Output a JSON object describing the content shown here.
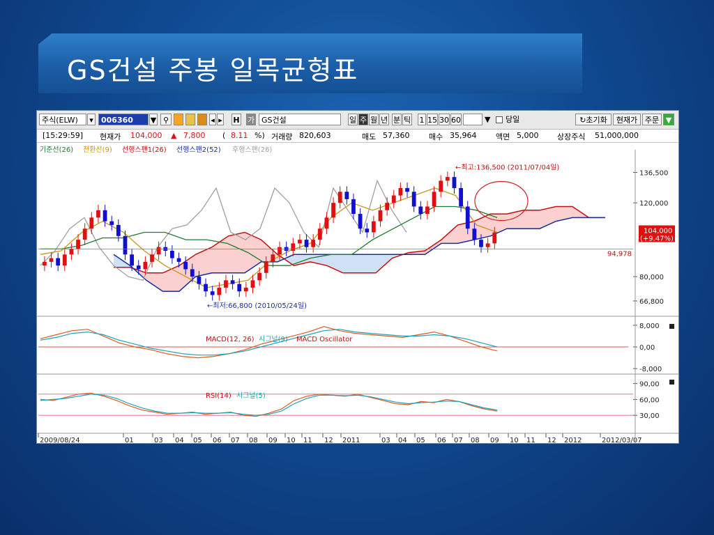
{
  "slide": {
    "title": "GS건설 주봉 일목균형표"
  },
  "toolbar": {
    "market_select": "주식(ELW)",
    "code": "006360",
    "h_button": "H",
    "name_badge": "가",
    "stock_name": "GS건설",
    "period_day": "일",
    "period_week": "주",
    "period_month": "월",
    "period_year": "년",
    "period_minute": "분",
    "period_tick": "틱",
    "interval_1": "1",
    "interval_15": "15",
    "interval_30": "30",
    "interval_60": "60",
    "same_day_label": "당일",
    "reset_button": "초기화",
    "current_price_button": "현재가",
    "order_button": "주문"
  },
  "info": {
    "time": "[15:29:59]",
    "price_label": "현재가",
    "price": "104,000",
    "change_arrow": "▲",
    "change": "7,800",
    "pct_open": "(",
    "pct": "8.11",
    "pct_close": "%)",
    "volume_label": "거래량",
    "volume": "820,603",
    "ask_label": "매도",
    "ask": "57,360",
    "bid_label": "매수",
    "bid": "35,964",
    "face_label": "액면",
    "face": "5,000",
    "listed_label": "상장주식",
    "listed": "51,000,000"
  },
  "legend": {
    "base": "기준선(26)",
    "conversion": "전환선(9)",
    "span1": "선행스팬1(26)",
    "span2": "선행스팬2(52)",
    "lagging": "후행스팬(26)"
  },
  "annotations": {
    "high": "←최고:136,500 (2011/07/04일)",
    "low": "←최저:66,800 (2010/05/24일)",
    "price_line": "94,978",
    "current_box_price": "104,000",
    "current_box_pct": "(+9.47%)"
  },
  "macd": {
    "label1": "MACD(12, 26)",
    "label2": "시그널(9)",
    "label3": "MACD Oscillator"
  },
  "rsi": {
    "label1": "RSI(14)",
    "label2": "시그널(5)"
  },
  "colors": {
    "base": "#1f7a2e",
    "conversion": "#c9961a",
    "span1": "#c01010",
    "span2": "#1a2f9a",
    "lagging": "#a0a0a0",
    "candle_up": "#e01010",
    "candle_down": "#1010d0"
  },
  "chart_data": [
    {
      "type": "line",
      "chart": "ichimoku candlestick",
      "y_ticks": [
        "136,500",
        "120,000",
        "80,000",
        "66,800"
      ],
      "ylim": [
        60000,
        145000
      ],
      "x_ticks": [
        "2009/08/24",
        "01",
        "03",
        "04",
        "05",
        "06",
        "07",
        "08",
        "09",
        "10",
        "11",
        "12",
        "2011",
        "03",
        "04",
        "05",
        "06",
        "07",
        "08",
        "09",
        "10",
        "11",
        "12",
        "2012",
        "2012/03/07"
      ],
      "candles_close": [
        88000,
        90000,
        86000,
        92000,
        95000,
        100000,
        106000,
        112000,
        116000,
        110000,
        108000,
        102000,
        92000,
        86000,
        84000,
        88000,
        92000,
        96000,
        94000,
        90000,
        88000,
        84000,
        80000,
        76000,
        72000,
        70000,
        74000,
        78000,
        76000,
        72000,
        74000,
        78000,
        82000,
        88000,
        92000,
        96000,
        94000,
        98000,
        100000,
        96000,
        100000,
        106000,
        112000,
        120000,
        126000,
        122000,
        114000,
        106000,
        104000,
        110000,
        116000,
        120000,
        124000,
        128000,
        126000,
        118000,
        114000,
        118000,
        126000,
        132000,
        134000,
        128000,
        118000,
        106000,
        100000,
        96000,
        98000,
        104000
      ],
      "series": [
        {
          "name": "기준선(26)",
          "values": [
            95000,
            95000,
            97000,
            101000,
            101000,
            104000,
            104000,
            100000,
            100000,
            98000,
            93000,
            86000,
            86000,
            90000,
            92000,
            92000,
            100000,
            106000,
            112000,
            118000,
            118000,
            116000,
            112000
          ]
        },
        {
          "name": "전환선(9)",
          "values": [
            92000,
            94000,
            104000,
            110000,
            104000,
            94000,
            86000,
            80000,
            74000,
            76000,
            78000,
            88000,
            94000,
            98000,
            112000,
            120000,
            116000,
            120000,
            124000,
            128000,
            124000,
            108000,
            104000
          ]
        },
        {
          "name": "선행스팬1(26)",
          "values": [
            85000,
            85000,
            82000,
            82000,
            86000,
            92000,
            96000,
            102000,
            104000,
            100000,
            92000,
            86000,
            88000,
            86000,
            82000,
            82000,
            82000,
            90000,
            93000,
            94000,
            100000,
            108000,
            110000,
            114000,
            114000,
            116000,
            116000,
            118000,
            118000,
            112000,
            112000
          ]
        },
        {
          "name": "선행스팬2(52)",
          "values": [
            92000,
            86000,
            78000,
            72000,
            72000,
            80000,
            82000,
            82000,
            82000,
            88000,
            88000,
            92000,
            92000,
            92000,
            92000,
            92000,
            92000,
            92000,
            92000,
            92000,
            98000,
            98000,
            100000,
            102000,
            106000,
            106000,
            106000,
            110000,
            112000,
            112000,
            112000
          ]
        },
        {
          "name": "후행스팬(26)",
          "values": [
            86000,
            94000,
            106000,
            112000,
            96000,
            86000,
            80000,
            78000,
            96000,
            106000,
            108000,
            116000,
            128000,
            104000,
            100000,
            106000,
            128000,
            120000,
            104000,
            96000,
            128000,
            116000,
            104000,
            132000,
            116000,
            104000
          ]
        }
      ]
    },
    {
      "type": "line",
      "chart": "MACD",
      "y_ticks": [
        "8,000",
        "0,00",
        "-8,000"
      ],
      "ylim": [
        -9000,
        9000
      ],
      "series": [
        {
          "name": "MACD(12, 26)",
          "values": [
            3000,
            4500,
            6000,
            6500,
            4000,
            1500,
            0,
            -1000,
            -2500,
            -3500,
            -4000,
            -3500,
            -2500,
            -1000,
            1000,
            2500,
            4000,
            5500,
            7500,
            6000,
            5000,
            4500,
            4000,
            3500,
            4500,
            5500,
            4000,
            2000,
            0,
            -1500
          ]
        },
        {
          "name": "시그널(9)",
          "values": [
            2500,
            3500,
            5000,
            5500,
            4500,
            2500,
            1000,
            -500,
            -1500,
            -2500,
            -3000,
            -3000,
            -2500,
            -1500,
            0,
            1500,
            3000,
            4500,
            6000,
            6500,
            5500,
            5000,
            4500,
            4000,
            4000,
            4500,
            4000,
            3000,
            1500,
            0
          ]
        }
      ]
    },
    {
      "type": "line",
      "chart": "RSI",
      "y_ticks": [
        "90,00",
        "60,00",
        "30,00"
      ],
      "ylim": [
        0,
        100
      ],
      "series": [
        {
          "name": "RSI(14)",
          "values": [
            60,
            58,
            64,
            70,
            72,
            66,
            58,
            48,
            40,
            36,
            32,
            34,
            36,
            32,
            34,
            36,
            30,
            28,
            34,
            42,
            58,
            66,
            70,
            68,
            66,
            70,
            64,
            58,
            52,
            50,
            56,
            54,
            60,
            56,
            48,
            42,
            38
          ]
        },
        {
          "name": "시그널(5)",
          "values": [
            58,
            60,
            62,
            66,
            70,
            68,
            62,
            52,
            44,
            38,
            34,
            34,
            35,
            34,
            34,
            35,
            32,
            30,
            32,
            38,
            52,
            62,
            68,
            68,
            67,
            68,
            65,
            60,
            55,
            52,
            54,
            55,
            57,
            56,
            50,
            44,
            40
          ]
        }
      ]
    }
  ]
}
